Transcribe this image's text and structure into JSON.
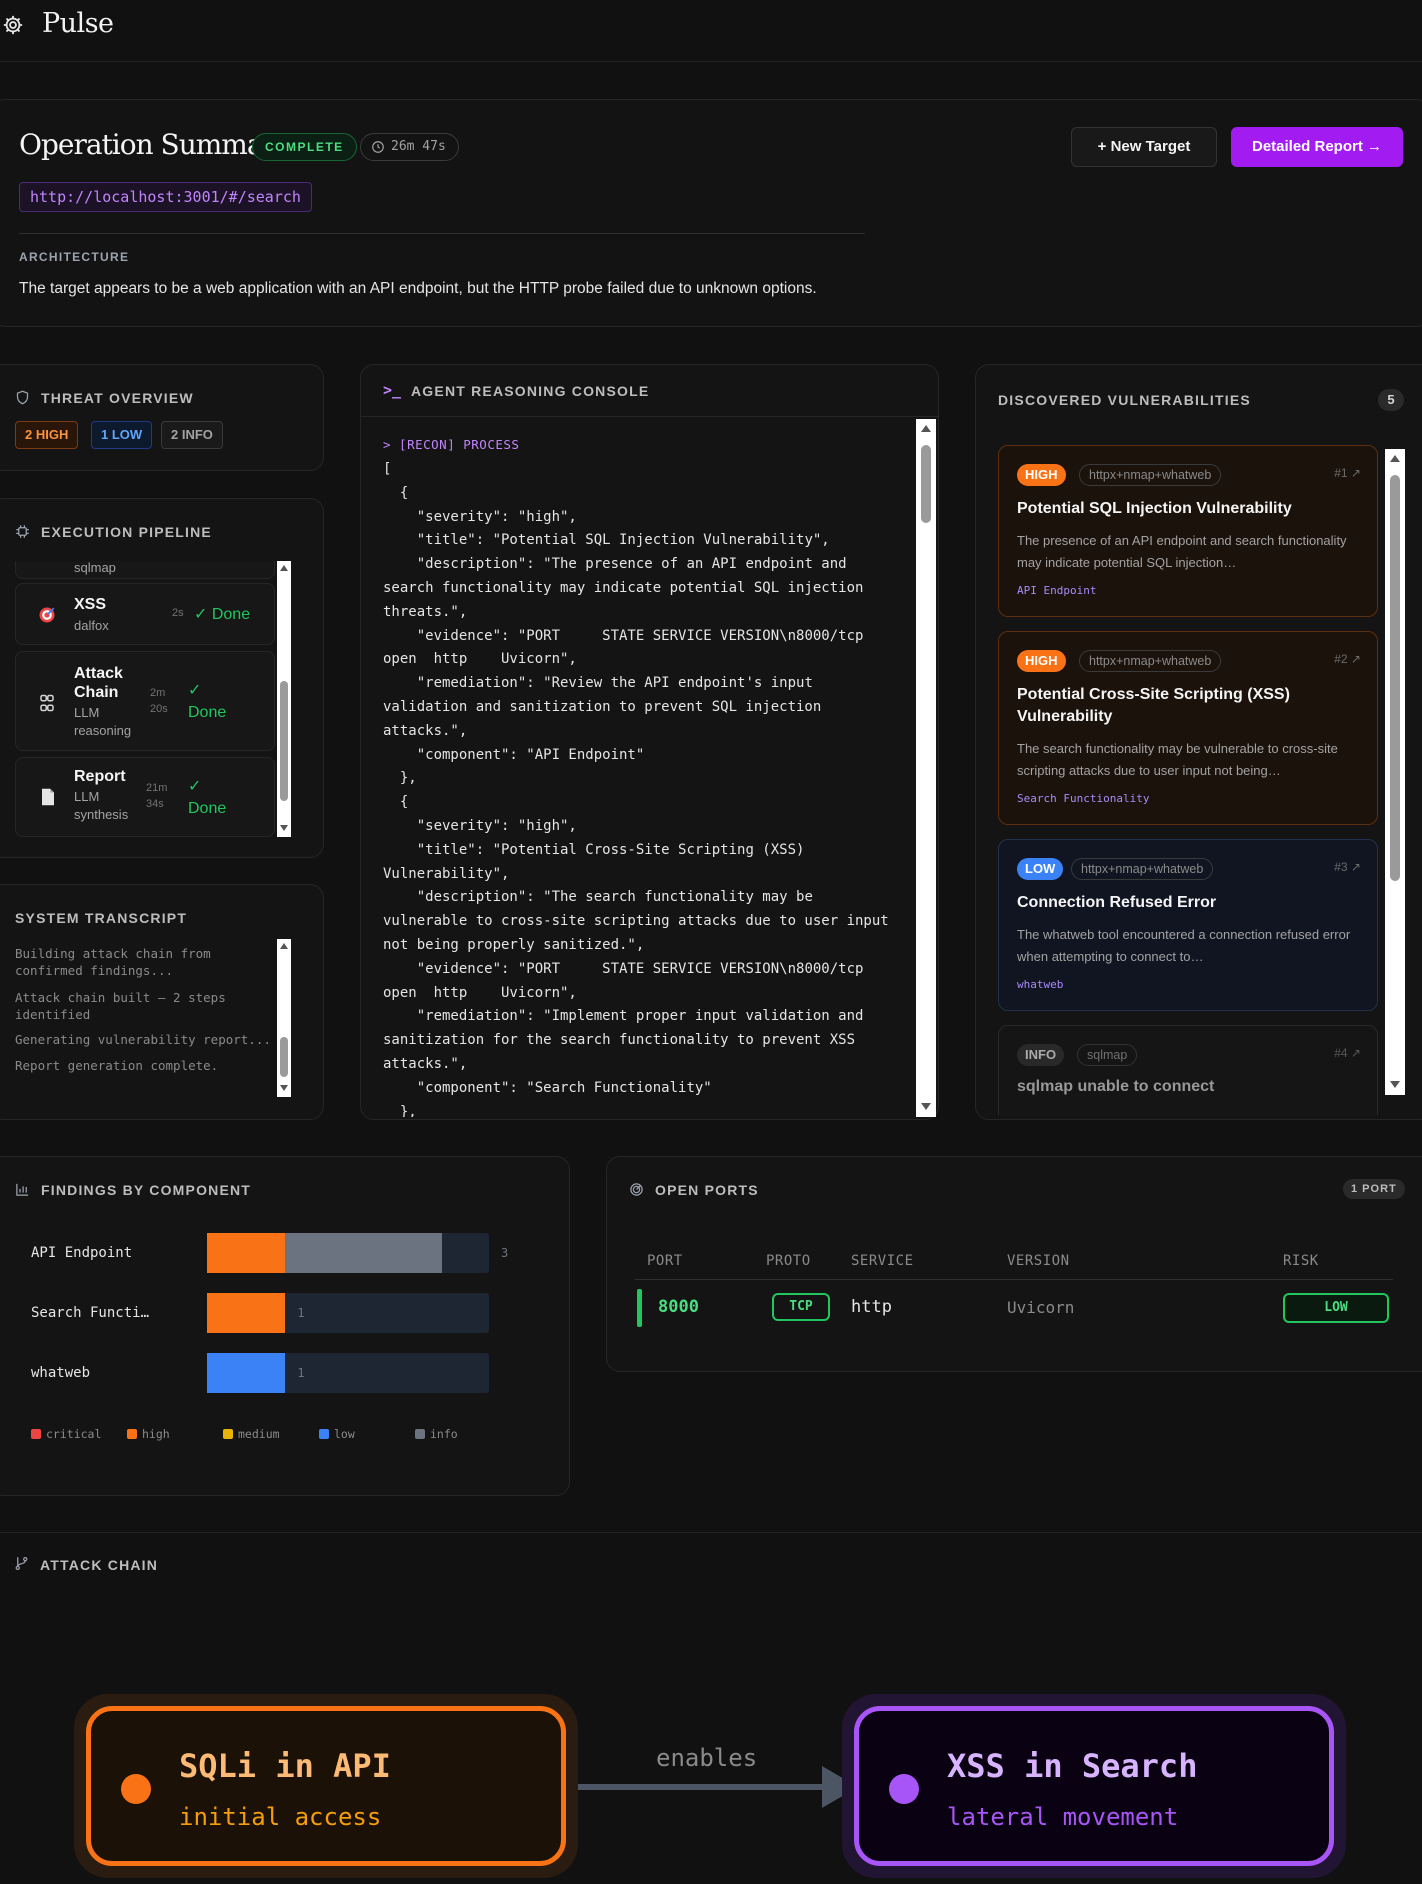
{
  "app": {
    "name": "Pulse"
  },
  "summary": {
    "title": "Operation Summary",
    "status": "COMPLETE",
    "duration": "26m 47s",
    "target_url": "http://localhost:3001/#/search",
    "architecture_label": "ARCHITECTURE",
    "architecture_text": "The target appears to be a web application with an API endpoint, but the HTTP probe failed due to unknown options.",
    "new_target_label": "+ New Target",
    "report_label": "Detailed Report →"
  },
  "threat": {
    "title": "THREAT OVERVIEW",
    "high": "2 HIGH",
    "low": "1 LOW",
    "info": "2 INFO"
  },
  "pipeline": {
    "title": "EXECUTION PIPELINE",
    "partial_sub": "sqlmap",
    "steps": [
      {
        "name": "XSS",
        "sub": "dalfox",
        "time": "2s",
        "status": "✓ Done"
      },
      {
        "name": "Attack Chain",
        "sub": "LLM reasoning",
        "time": "2m 20s",
        "status": "✓ Done"
      },
      {
        "name": "Report",
        "sub": "LLM synthesis",
        "time": "21m 34s",
        "status": "✓ Done"
      }
    ]
  },
  "transcript": {
    "title": "SYSTEM TRANSCRIPT",
    "lines": [
      "Building attack chain from confirmed findings...",
      "Attack chain built — 2 steps identified",
      "Generating vulnerability report...",
      "Report generation complete."
    ]
  },
  "console": {
    "title": "AGENT REASONING CONSOLE",
    "prompt": "> [RECON] PROCESS",
    "body": "[\n  {\n    \"severity\": \"high\",\n    \"title\": \"Potential SQL Injection Vulnerability\",\n    \"description\": \"The presence of an API endpoint and search functionality may indicate potential SQL injection threats.\",\n    \"evidence\": \"PORT     STATE SERVICE VERSION\\n8000/tcp open  http    Uvicorn\",\n    \"remediation\": \"Review the API endpoint's input validation and sanitization to prevent SQL injection attacks.\",\n    \"component\": \"API Endpoint\"\n  },\n  {\n    \"severity\": \"high\",\n    \"title\": \"Potential Cross-Site Scripting (XSS) Vulnerability\",\n    \"description\": \"The search functionality may be vulnerable to cross-site scripting attacks due to user input not being properly sanitized.\",\n    \"evidence\": \"PORT     STATE SERVICE VERSION\\n8000/tcp open  http    Uvicorn\",\n    \"remediation\": \"Implement proper input validation and sanitization for the search functionality to prevent XSS attacks.\",\n    \"component\": \"Search Functionality\"\n  },\n  {"
  },
  "vulns": {
    "title": "DISCOVERED VULNERABILITIES",
    "count": "5",
    "items": [
      {
        "severity": "HIGH",
        "tool": "httpx+nmap+whatweb",
        "num": "#1 ↗",
        "title": "Potential SQL Injection Vulnerability",
        "desc": "The presence of an API endpoint and search functionality may indicate potential SQL injection…",
        "component": "API Endpoint"
      },
      {
        "severity": "HIGH",
        "tool": "httpx+nmap+whatweb",
        "num": "#2 ↗",
        "title": "Potential Cross-Site Scripting (XSS) Vulnerability",
        "desc": "The search functionality may be vulnerable to cross-site scripting attacks due to user input not being…",
        "component": "Search Functionality"
      },
      {
        "severity": "LOW",
        "tool": "httpx+nmap+whatweb",
        "num": "#3 ↗",
        "title": "Connection Refused Error",
        "desc": "The whatweb tool encountered a connection refused error when attempting to connect to…",
        "component": "whatweb"
      },
      {
        "severity": "INFO",
        "tool": "sqlmap",
        "num": "#4 ↗",
        "title": "sqlmap unable to connect",
        "desc": "",
        "component": ""
      }
    ]
  },
  "findings": {
    "title": "FINDINGS BY COMPONENT",
    "chart_data": {
      "type": "bar",
      "categories": [
        "API Endpoint",
        "Search Functi…",
        "whatweb"
      ],
      "series": [
        {
          "name": "critical",
          "values": [
            0,
            0,
            0
          ]
        },
        {
          "name": "high",
          "values": [
            1,
            1,
            0
          ]
        },
        {
          "name": "medium",
          "values": [
            0,
            0,
            0
          ]
        },
        {
          "name": "low",
          "values": [
            0,
            0,
            1
          ]
        },
        {
          "name": "info",
          "values": [
            2,
            0,
            0
          ]
        }
      ],
      "totals": [
        "3",
        "1",
        "1"
      ],
      "xlim": [
        0,
        3.6
      ],
      "legend": [
        "critical",
        "high",
        "medium",
        "low",
        "info"
      ],
      "colors": {
        "critical": "#ef4444",
        "high": "#f97316",
        "medium": "#eab308",
        "low": "#3b82f6",
        "info": "#6b7280"
      }
    }
  },
  "ports": {
    "title": "OPEN PORTS",
    "count": "1 PORT",
    "columns": [
      "PORT",
      "PROTO",
      "SERVICE",
      "VERSION",
      "RISK"
    ],
    "rows": [
      {
        "port": "8000",
        "proto": "TCP",
        "service": "http",
        "version": "Uvicorn",
        "risk": "LOW"
      }
    ]
  },
  "chain": {
    "title": "ATTACK CHAIN",
    "edge_label": "enables",
    "nodes": [
      {
        "title": "SQLi in API",
        "sub": "initial access"
      },
      {
        "title": "XSS in Search",
        "sub": "lateral movement"
      }
    ]
  }
}
